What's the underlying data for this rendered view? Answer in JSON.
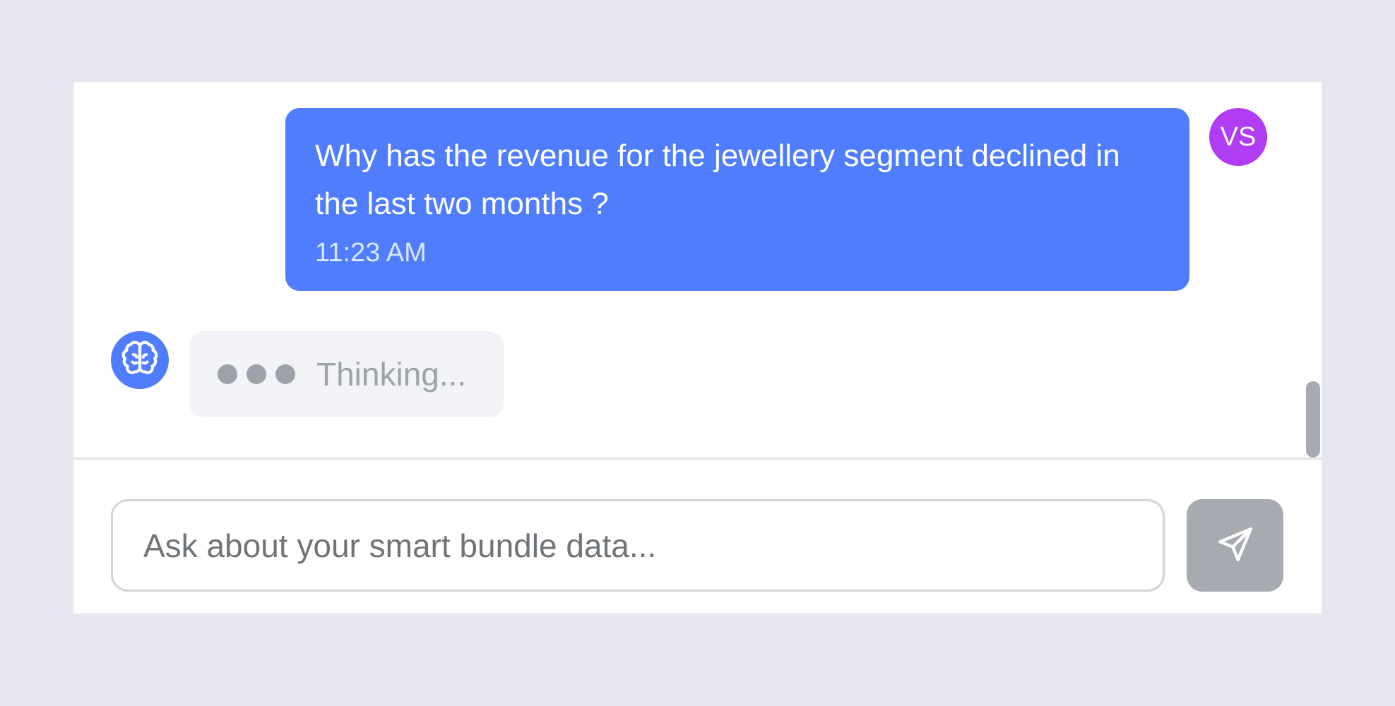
{
  "chat": {
    "user_message": {
      "text": "Why has the revenue for the jewellery segment declined in the last two months ?",
      "time": "11:23 AM",
      "avatar_initials": "VS"
    },
    "assistant": {
      "status_text": "Thinking...",
      "avatar_icon": "brain-icon"
    }
  },
  "composer": {
    "placeholder": "Ask about your smart bundle data...",
    "value": "",
    "send_icon": "send-icon"
  },
  "colors": {
    "user_bubble": "#4f7dfd",
    "user_avatar": "#b03cf3",
    "bot_avatar": "#4f7dfd",
    "send_button": "#a7abb1"
  }
}
